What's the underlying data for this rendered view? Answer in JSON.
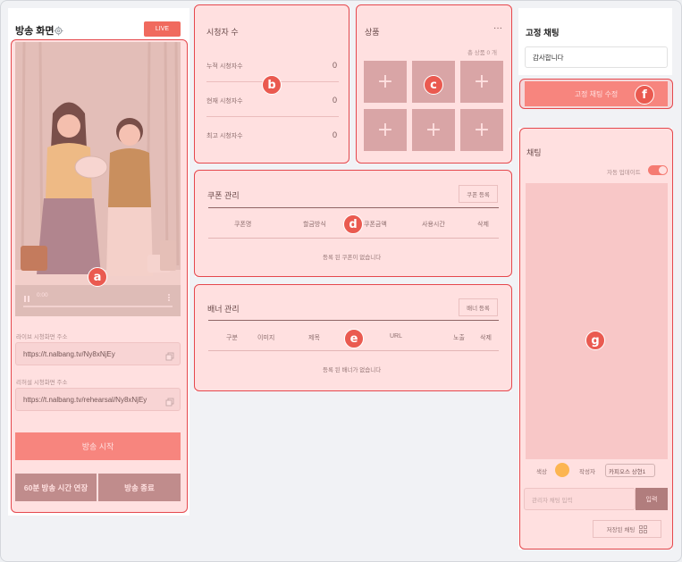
{
  "colors": {
    "accent": "#f06a5e",
    "highlight_border": "#e5484d",
    "marker": "#ea5a50",
    "dark_button": "#a38383",
    "chat_color": "#fbc02d"
  },
  "broadcast": {
    "title": "방송 화면",
    "settings_icon": "gear-icon",
    "live_badge": "LIVE",
    "video_time": "0:00",
    "play_icon": "pause-icon",
    "more_icon": "more-vertical-icon",
    "live_url_label": "라이브 시청화면 주소",
    "live_url": "https://t.nalbang.tv/Ny8xNjEy",
    "rehearsal_url_label": "리허설 시청화면 주소",
    "rehearsal_url": "https://t.nalbang.tv/rehearsal/Ny8xNjEy",
    "copy_icon": "copy-icon",
    "start_button": "방송 시작",
    "extend_button": "60분 방송 시간 연장",
    "end_button": "방송 종료"
  },
  "viewers": {
    "title": "시청자 수",
    "rows": [
      {
        "label": "누적 시청자수",
        "value": "0"
      },
      {
        "label": "현재 시청자수",
        "value": "0"
      },
      {
        "label": "최고 시청자수",
        "value": "0"
      }
    ]
  },
  "products": {
    "title": "상품",
    "more": "···",
    "count": "총 상품 0 개",
    "add_glyph": "+"
  },
  "coupons": {
    "title": "쿠폰 관리",
    "register_button": "쿠폰 등록",
    "columns": [
      "쿠폰명",
      "할금방식",
      "쿠폰금액",
      "사용시간",
      "삭제"
    ],
    "empty": "등록 된 쿠폰이 없습니다"
  },
  "banners": {
    "title": "배너 관리",
    "register_button": "배너 등록",
    "columns": [
      "구분",
      "이미지",
      "제목",
      "URL",
      "노출",
      "삭제"
    ],
    "empty": "등록 된 배너가 없습니다"
  },
  "pinned_chat": {
    "title": "고정 채팅",
    "value": "감사합니다",
    "edit_button": "고정 채팅 수정"
  },
  "chat": {
    "title": "채팅",
    "auto_update_label": "자동 업데이트",
    "auto_update_on": true,
    "color_label": "색상",
    "author_label": "작성자",
    "author_value": "카피오스 상현1",
    "input_placeholder": "관리자 채팅 입력",
    "submit_button": "입력",
    "saved_button": "저장된 채팅",
    "saved_icon": "grid-icon"
  },
  "markers": [
    "a",
    "b",
    "c",
    "d",
    "e",
    "f",
    "g"
  ]
}
